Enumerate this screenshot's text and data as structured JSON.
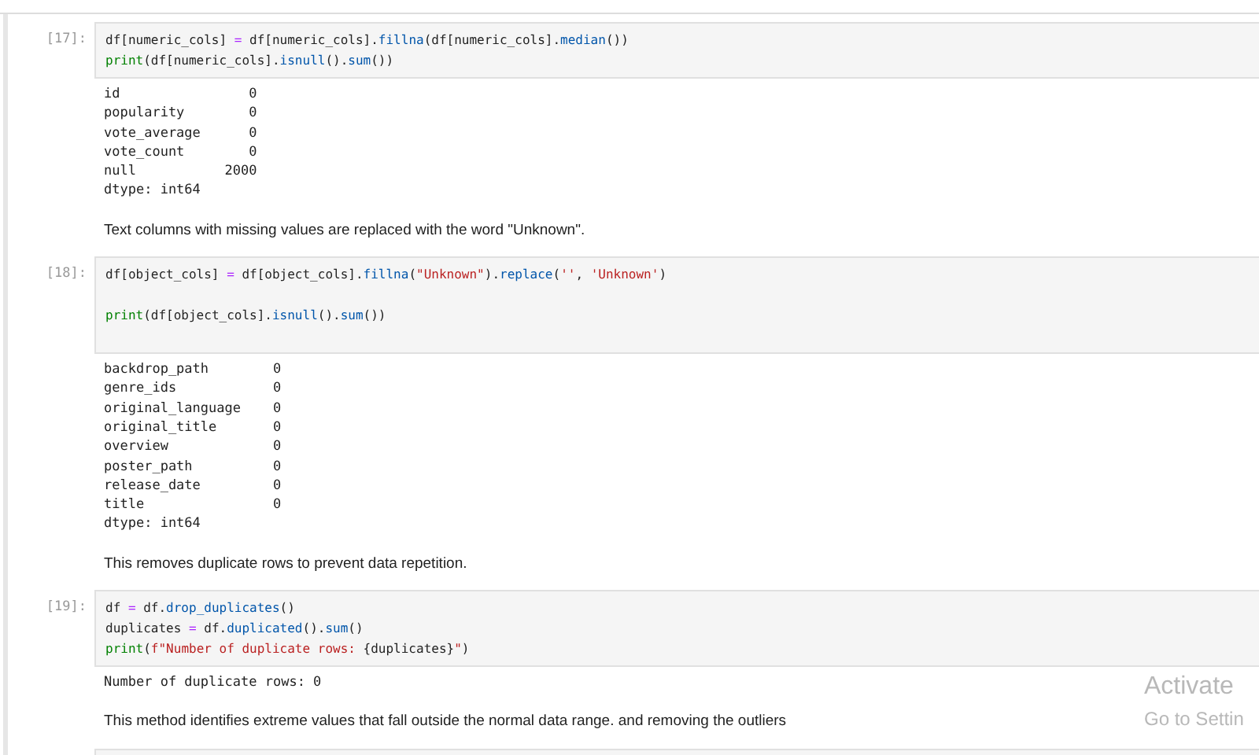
{
  "cells": [
    {
      "kind": "code",
      "prompt": "[17]:",
      "code": [
        {
          "kind": "code",
          "tokens": [
            {
              "text": "df[numeric_cols] ",
              "kind": "plain"
            },
            {
              "text": "=",
              "kind": "operator"
            },
            {
              "text": " df[numeric_cols].",
              "kind": "plain"
            },
            {
              "text": "fillna",
              "kind": "method"
            },
            {
              "text": "(df[numeric_cols].",
              "kind": "plain"
            },
            {
              "text": "median",
              "kind": "method"
            },
            {
              "text": "())",
              "kind": "plain"
            }
          ]
        },
        {
          "kind": "code",
          "tokens": [
            {
              "text": "print",
              "kind": "builtin"
            },
            {
              "text": "(df[numeric_cols].",
              "kind": "plain"
            },
            {
              "text": "isnull",
              "kind": "method"
            },
            {
              "text": "().",
              "kind": "plain"
            },
            {
              "text": "sum",
              "kind": "method"
            },
            {
              "text": "())",
              "kind": "plain"
            }
          ]
        }
      ],
      "output": [
        "id                0",
        "popularity        0",
        "vote_average      0",
        "vote_count        0",
        "null           2000",
        "dtype: int64"
      ]
    },
    {
      "kind": "markdown",
      "text": "Text columns with missing values are replaced with the word \"Unknown\"."
    },
    {
      "kind": "code",
      "prompt": "[18]:",
      "code": [
        {
          "kind": "code",
          "tokens": [
            {
              "text": "df[object_cols] ",
              "kind": "plain"
            },
            {
              "text": "=",
              "kind": "operator"
            },
            {
              "text": " df[object_cols].",
              "kind": "plain"
            },
            {
              "text": "fillna",
              "kind": "method"
            },
            {
              "text": "(",
              "kind": "plain"
            },
            {
              "text": "\"Unknown\"",
              "kind": "string"
            },
            {
              "text": ").",
              "kind": "plain"
            },
            {
              "text": "replace",
              "kind": "method"
            },
            {
              "text": "(",
              "kind": "plain"
            },
            {
              "text": "''",
              "kind": "string"
            },
            {
              "text": ", ",
              "kind": "plain"
            },
            {
              "text": "'Unknown'",
              "kind": "string"
            },
            {
              "text": ")",
              "kind": "plain"
            }
          ]
        },
        {
          "kind": "blank"
        },
        {
          "kind": "code",
          "tokens": [
            {
              "text": "print",
              "kind": "builtin"
            },
            {
              "text": "(df[object_cols].",
              "kind": "plain"
            },
            {
              "text": "isnull",
              "kind": "method"
            },
            {
              "text": "().",
              "kind": "plain"
            },
            {
              "text": "sum",
              "kind": "method"
            },
            {
              "text": "())",
              "kind": "plain"
            }
          ]
        },
        {
          "kind": "blank"
        }
      ],
      "output": [
        "backdrop_path        0",
        "genre_ids            0",
        "original_language    0",
        "original_title       0",
        "overview             0",
        "poster_path          0",
        "release_date         0",
        "title                0",
        "dtype: int64"
      ]
    },
    {
      "kind": "markdown",
      "text": "This removes duplicate rows to prevent data repetition."
    },
    {
      "kind": "code",
      "prompt": "[19]:",
      "code": [
        {
          "kind": "code",
          "tokens": [
            {
              "text": "df ",
              "kind": "plain"
            },
            {
              "text": "=",
              "kind": "operator"
            },
            {
              "text": " df.",
              "kind": "plain"
            },
            {
              "text": "drop_duplicates",
              "kind": "method"
            },
            {
              "text": "()",
              "kind": "plain"
            }
          ]
        },
        {
          "kind": "code",
          "tokens": [
            {
              "text": "duplicates ",
              "kind": "plain"
            },
            {
              "text": "=",
              "kind": "operator"
            },
            {
              "text": " df.",
              "kind": "plain"
            },
            {
              "text": "duplicated",
              "kind": "method"
            },
            {
              "text": "().",
              "kind": "plain"
            },
            {
              "text": "sum",
              "kind": "method"
            },
            {
              "text": "()",
              "kind": "plain"
            }
          ]
        },
        {
          "kind": "code",
          "tokens": [
            {
              "text": "print",
              "kind": "builtin"
            },
            {
              "text": "(",
              "kind": "plain"
            },
            {
              "text": "f\"Number of duplicate rows: ",
              "kind": "string"
            },
            {
              "text": "{duplicates}",
              "kind": "plain"
            },
            {
              "text": "\"",
              "kind": "string"
            },
            {
              "text": ")",
              "kind": "plain"
            }
          ]
        }
      ],
      "output": [
        "Number of duplicate rows: 0"
      ]
    },
    {
      "kind": "markdown",
      "text": "This method identifies extreme values that fall outside the normal data range. and removing the outliers"
    }
  ],
  "os_notice": {
    "title": "Activate",
    "subtitle": "Go to Settin"
  }
}
